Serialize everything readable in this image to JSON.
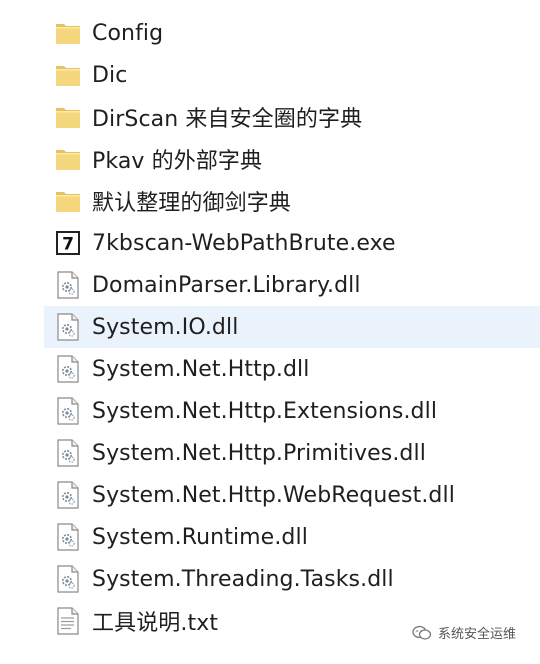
{
  "files": [
    {
      "type": "folder",
      "icon": "folder-icon",
      "name": "Config"
    },
    {
      "type": "folder",
      "icon": "folder-icon",
      "name": "Dic"
    },
    {
      "type": "folder",
      "icon": "folder-icon",
      "name": "DirScan 来自安全圈的字典"
    },
    {
      "type": "folder",
      "icon": "folder-icon",
      "name": "Pkav 的外部字典"
    },
    {
      "type": "folder",
      "icon": "folder-icon",
      "name": "默认整理的御剑字典"
    },
    {
      "type": "exe",
      "icon": "7zip-exe-icon",
      "name": "7kbscan-WebPathBrute.exe"
    },
    {
      "type": "dll",
      "icon": "dll-file-icon",
      "name": "DomainParser.Library.dll"
    },
    {
      "type": "dll",
      "icon": "dll-file-icon",
      "name": "System.IO.dll",
      "selected": true
    },
    {
      "type": "dll",
      "icon": "dll-file-icon",
      "name": "System.Net.Http.dll"
    },
    {
      "type": "dll",
      "icon": "dll-file-icon",
      "name": "System.Net.Http.Extensions.dll"
    },
    {
      "type": "dll",
      "icon": "dll-file-icon",
      "name": "System.Net.Http.Primitives.dll"
    },
    {
      "type": "dll",
      "icon": "dll-file-icon",
      "name": "System.Net.Http.WebRequest.dll"
    },
    {
      "type": "dll",
      "icon": "dll-file-icon",
      "name": "System.Runtime.dll"
    },
    {
      "type": "dll",
      "icon": "dll-file-icon",
      "name": "System.Threading.Tasks.dll"
    },
    {
      "type": "txt",
      "icon": "text-file-icon",
      "name": "工具说明.txt"
    }
  ],
  "watermark": {
    "icon": "wechat-icon",
    "text": "系统安全运维"
  },
  "colors": {
    "folder": "#f2cf70",
    "selected_row": "#eaf3fb"
  }
}
